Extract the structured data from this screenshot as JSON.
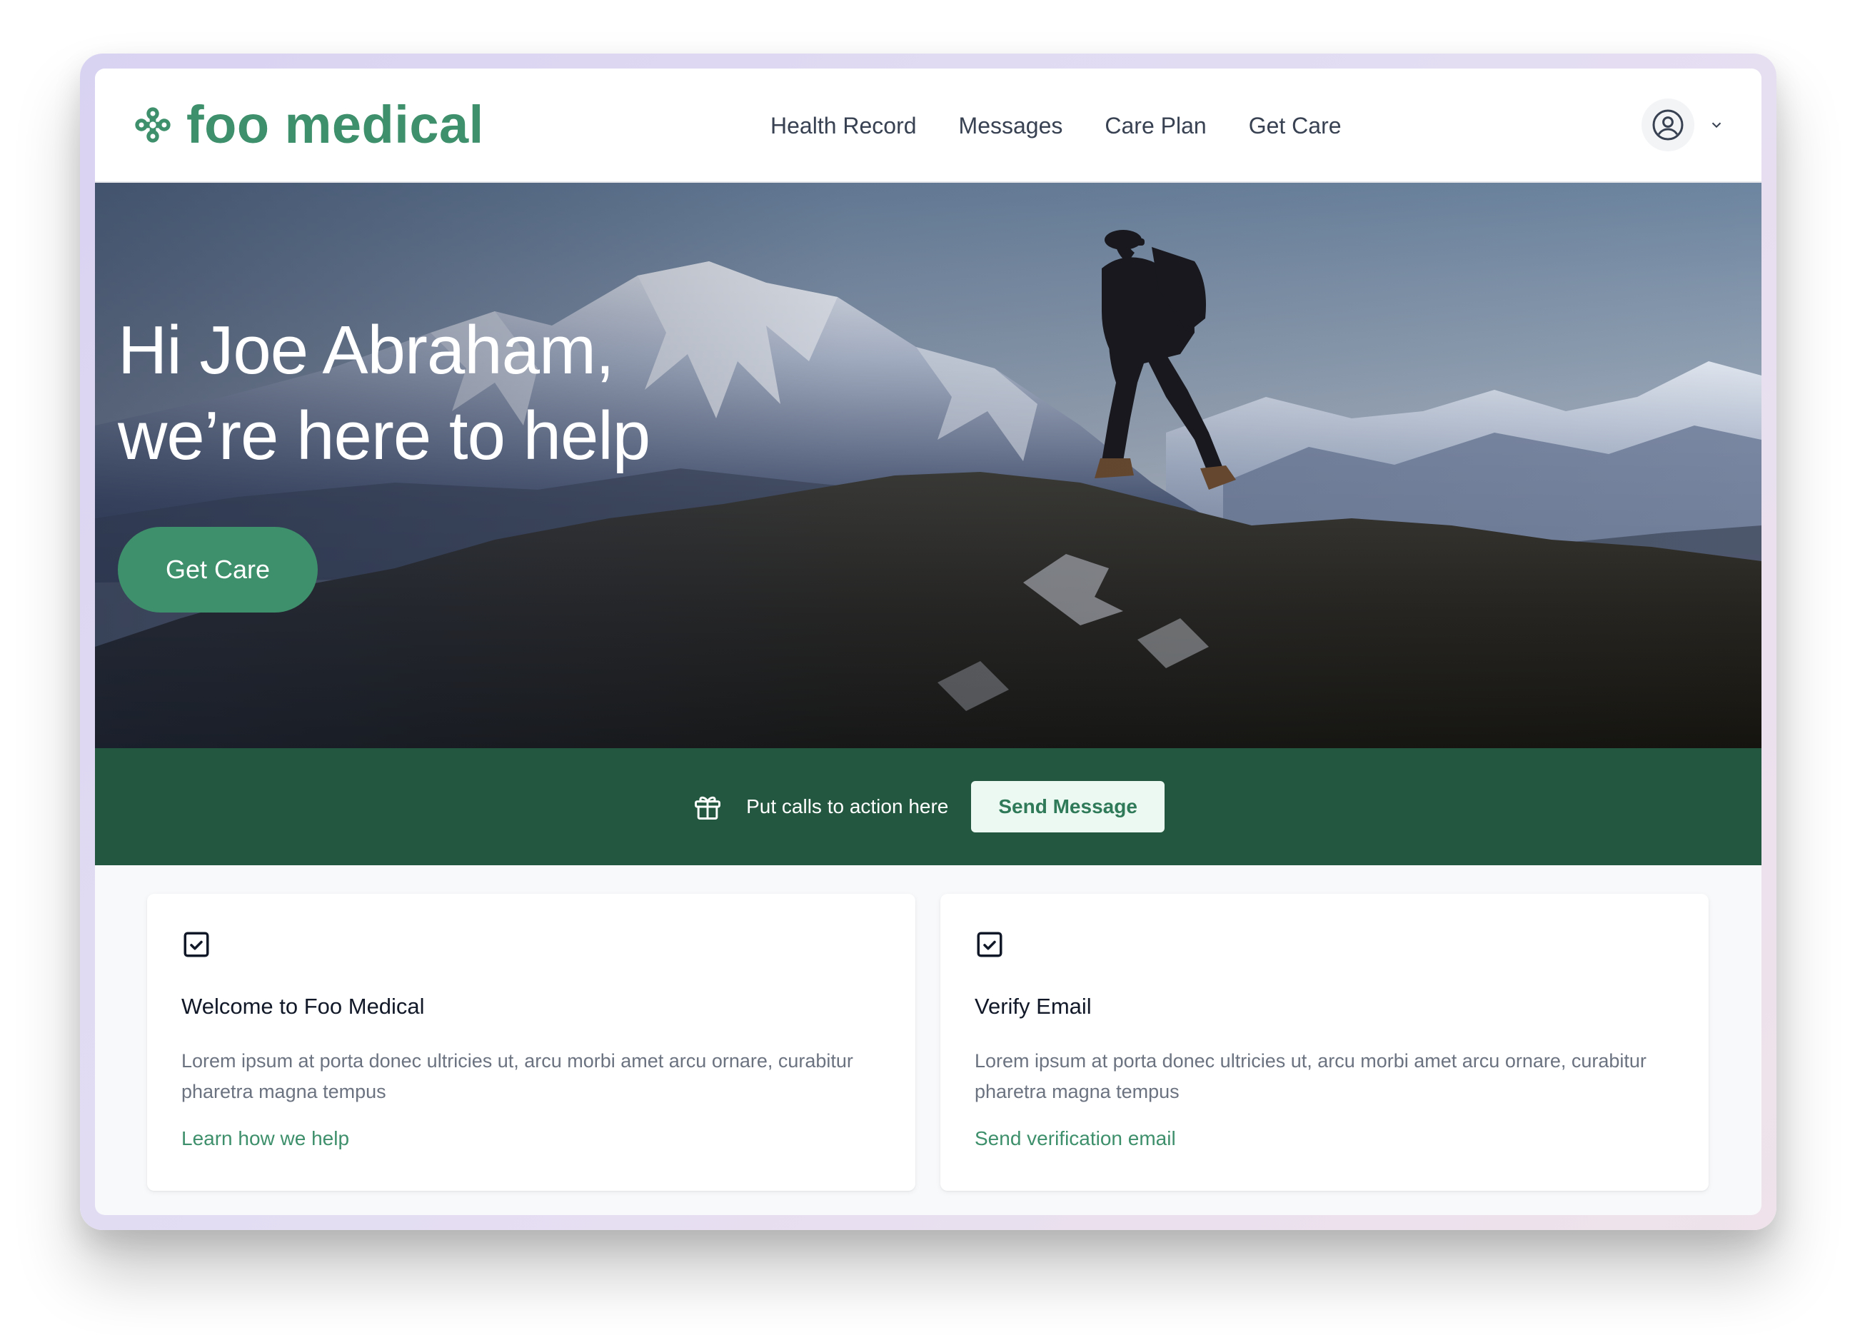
{
  "brand": {
    "name": "foo medical",
    "icon": "clover-cross-icon",
    "color": "#3e8f6b"
  },
  "nav": {
    "items": [
      {
        "label": "Health Record"
      },
      {
        "label": "Messages"
      },
      {
        "label": "Care Plan"
      },
      {
        "label": "Get Care"
      }
    ]
  },
  "user_menu": {
    "icon": "user-circle-icon",
    "caret_icon": "chevron-down-icon"
  },
  "hero": {
    "title_line1": "Hi Joe Abraham,",
    "title_line2": "we’re here to help",
    "button_label": "Get Care",
    "button_color": "#3e8f6b",
    "image": "mountain-hiker-photo"
  },
  "banner": {
    "icon": "gift-icon",
    "text": "Put calls to action here",
    "button_label": "Send Message",
    "background": "#24573f"
  },
  "cards": [
    {
      "icon": "checkbox-icon",
      "title": "Welcome to Foo Medical",
      "description": "Lorem ipsum at porta donec ultricies ut, arcu morbi amet arcu ornare, curabitur pharetra magna tempus",
      "link": "Learn how we help"
    },
    {
      "icon": "checkbox-icon",
      "title": "Verify Email",
      "description": "Lorem ipsum at porta donec ultricies ut, arcu morbi amet arcu ornare, curabitur pharetra magna tempus",
      "link": "Send verification email"
    }
  ]
}
